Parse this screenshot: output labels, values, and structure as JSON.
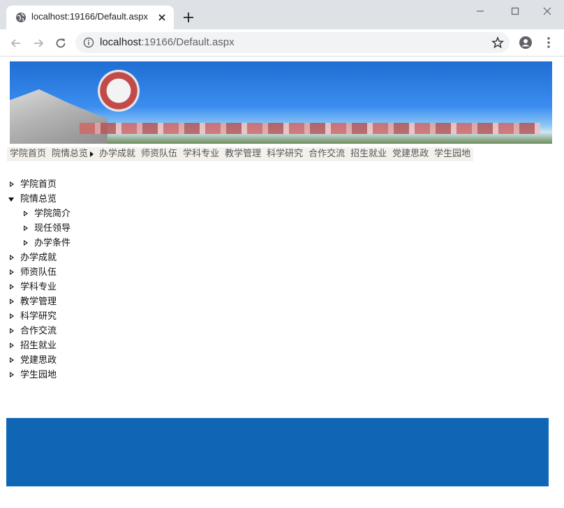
{
  "browser": {
    "tab_title": "localhost:19166/Default.aspx",
    "url_host": "localhost",
    "url_path": ":19166/Default.aspx"
  },
  "banner": {
    "logo_text": "",
    "logo_sub": ""
  },
  "menu": {
    "items": [
      {
        "label": "学院首页"
      },
      {
        "label": "院情总览"
      },
      {
        "label": "办学成就"
      },
      {
        "label": "师资队伍"
      },
      {
        "label": "学科专业"
      },
      {
        "label": "教学管理"
      },
      {
        "label": "科学研究"
      },
      {
        "label": "合作交流"
      },
      {
        "label": "招生就业"
      },
      {
        "label": "党建思政"
      },
      {
        "label": "学生园地"
      }
    ]
  },
  "tree": {
    "nodes": [
      {
        "label": "学院首页",
        "state": "collapsed",
        "level": 0
      },
      {
        "label": "院情总览",
        "state": "expanded",
        "level": 0
      },
      {
        "label": "学院简介",
        "state": "collapsed",
        "level": 1
      },
      {
        "label": "现任领导",
        "state": "collapsed",
        "level": 1
      },
      {
        "label": "办学条件",
        "state": "collapsed",
        "level": 1
      },
      {
        "label": "办学成就",
        "state": "collapsed",
        "level": 0
      },
      {
        "label": "师资队伍",
        "state": "collapsed",
        "level": 0
      },
      {
        "label": "学科专业",
        "state": "collapsed",
        "level": 0
      },
      {
        "label": "教学管理",
        "state": "collapsed",
        "level": 0
      },
      {
        "label": "科学研究",
        "state": "collapsed",
        "level": 0
      },
      {
        "label": "合作交流",
        "state": "collapsed",
        "level": 0
      },
      {
        "label": "招生就业",
        "state": "collapsed",
        "level": 0
      },
      {
        "label": "党建思政",
        "state": "collapsed",
        "level": 0
      },
      {
        "label": "学生园地",
        "state": "collapsed",
        "level": 0
      }
    ]
  },
  "footer": {
    "line1": "",
    "line2": ""
  },
  "colors": {
    "tabstrip": "#dee1e6",
    "menubar_bg": "#f4f1ec",
    "footer_bg": "#0e66b5"
  }
}
